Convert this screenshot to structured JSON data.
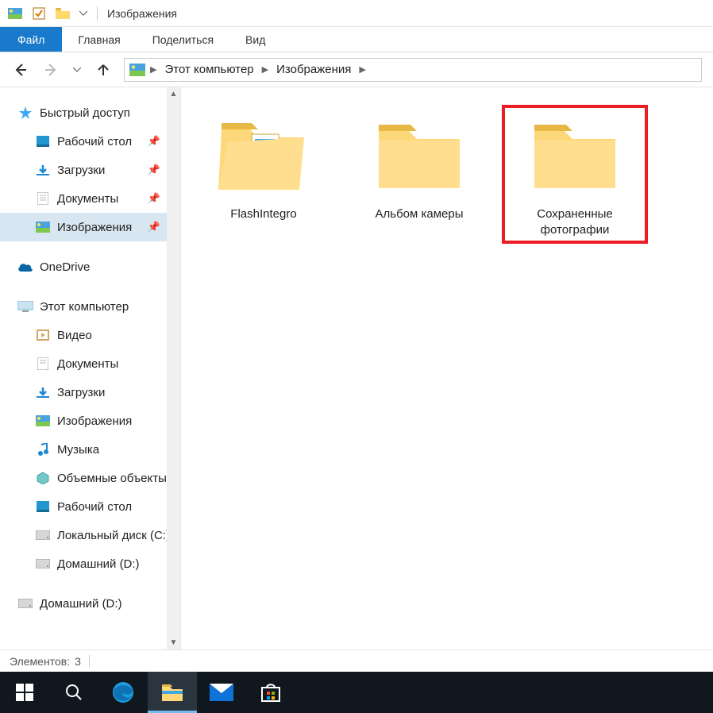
{
  "window": {
    "title": "Изображения"
  },
  "ribbon": {
    "file": "Файл",
    "tabs": [
      "Главная",
      "Поделиться",
      "Вид"
    ]
  },
  "breadcrumb": {
    "items": [
      "Этот компьютер",
      "Изображения"
    ]
  },
  "sidebar": {
    "quick_access": {
      "label": "Быстрый доступ"
    },
    "quick_items": [
      {
        "label": "Рабочий стол",
        "icon": "desktop",
        "pinned": true
      },
      {
        "label": "Загрузки",
        "icon": "downloads",
        "pinned": true
      },
      {
        "label": "Документы",
        "icon": "documents",
        "pinned": true
      },
      {
        "label": "Изображения",
        "icon": "pictures",
        "pinned": true,
        "selected": true
      }
    ],
    "onedrive": {
      "label": "OneDrive"
    },
    "this_pc": {
      "label": "Этот компьютер"
    },
    "pc_items": [
      {
        "label": "Видео",
        "icon": "videos"
      },
      {
        "label": "Документы",
        "icon": "documents"
      },
      {
        "label": "Загрузки",
        "icon": "downloads"
      },
      {
        "label": "Изображения",
        "icon": "pictures"
      },
      {
        "label": "Музыка",
        "icon": "music"
      },
      {
        "label": "Объемные объекты",
        "icon": "objects3d"
      },
      {
        "label": "Рабочий стол",
        "icon": "desktop"
      },
      {
        "label": "Локальный диск (C:)",
        "icon": "drive"
      },
      {
        "label": "Домашний (D:)",
        "icon": "drive"
      }
    ],
    "extra_drive": {
      "label": "Домашний (D:)"
    }
  },
  "content": {
    "folders": [
      {
        "label": "FlashIntegro",
        "kind": "folder-open"
      },
      {
        "label": "Альбом камеры",
        "kind": "folder"
      },
      {
        "label": "Сохраненные фотографии",
        "kind": "folder",
        "highlight": true
      }
    ]
  },
  "status": {
    "prefix": "Элементов:",
    "count": "3"
  },
  "taskbar": {
    "items": [
      "start",
      "search",
      "edge",
      "explorer",
      "mail",
      "store"
    ]
  }
}
